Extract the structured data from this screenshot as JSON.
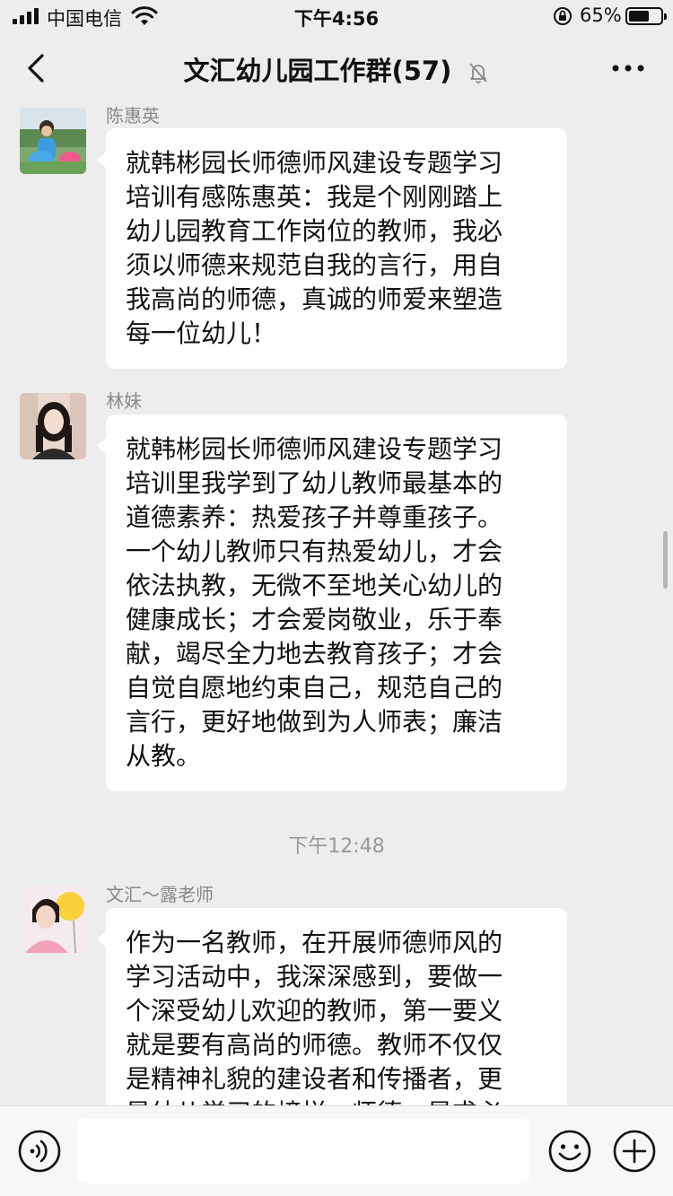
{
  "status_bar": {
    "carrier": "中国电信",
    "time": "下午4:56",
    "battery_percent": "65%",
    "battery_level": 0.65
  },
  "nav": {
    "title": "文汇幼儿园工作群(57)",
    "muted": true,
    "icons": {
      "back": "chevron-left-icon",
      "mute": "bell-off-icon",
      "more": "more-dots-icon"
    }
  },
  "messages": [
    {
      "sender": "陈惠英",
      "lines": [
        "就韩彬园长师德师风建设专题学习",
        "培训有感陈惠英：我是个刚刚踏上",
        "幼儿园教育工作岗位的教师，我必",
        "须以师德来规范自我的言行，用自",
        "我高尚的师德，真诚的师爱来塑造",
        "每一位幼儿！"
      ]
    },
    {
      "sender": "林妹",
      "lines": [
        "就韩彬园长师德师风建设专题学习",
        "培训里我学到了幼儿教师最基本的",
        "道德素养：热爱孩子并尊重孩子。",
        "一个幼儿教师只有热爱幼儿，才会",
        "依法执教，无微不至地关心幼儿的",
        "健康成长；才会爱岗敬业，乐于奉",
        "献，竭尽全力地去教育孩子；才会",
        "自觉自愿地约束自己，规范自己的",
        "言行，更好地做到为人师表；廉洁",
        "从教。"
      ]
    },
    {
      "sender": "文汇～露老师",
      "lines": [
        "作为一名教师，在开展师德师风的",
        "学习活动中，我深深感到，要做一",
        "个深受幼儿欢迎的教师，第一要义",
        "就是要有高尚的师德。教师不仅仅",
        "是精神礼貌的建设者和传播者，更",
        "是幼儿学习的榜样，师德，是求必"
      ]
    }
  ],
  "timestamp": "下午12:48",
  "input_bar": {
    "placeholder": "",
    "icons": {
      "voice": "voice-icon",
      "emoji": "emoji-icon",
      "plus": "plus-circle-icon"
    }
  },
  "colors": {
    "background": "#ededed",
    "bubble": "#ffffff",
    "sender_text": "#888888",
    "timestamp_text": "#999999"
  }
}
